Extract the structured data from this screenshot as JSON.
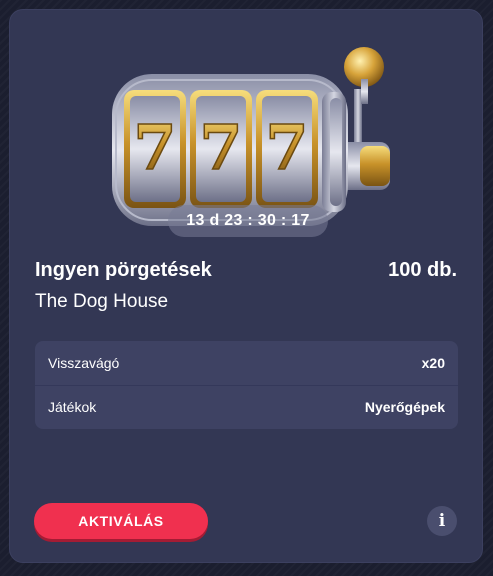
{
  "promo": {
    "timer": "13 d 23 : 30 : 17",
    "title": "Ingyen pörgetések",
    "amount": "100 db.",
    "game": "The Dog House",
    "details": [
      {
        "label": "Visszavágó",
        "value": "x20"
      },
      {
        "label": "Játékok",
        "value": "Nyerőgépek"
      }
    ],
    "activate_label": "AKTIVÁLÁS",
    "info_label": "i",
    "reel_symbols": [
      "7",
      "7",
      "7"
    ],
    "icons": {
      "slot_machine": "slot-machine-icon",
      "info": "info-icon"
    },
    "colors": {
      "card_bg": "#333754",
      "detail_bg": "#3e4263",
      "accent": "#f0304f",
      "gold": "#d9a730"
    }
  }
}
